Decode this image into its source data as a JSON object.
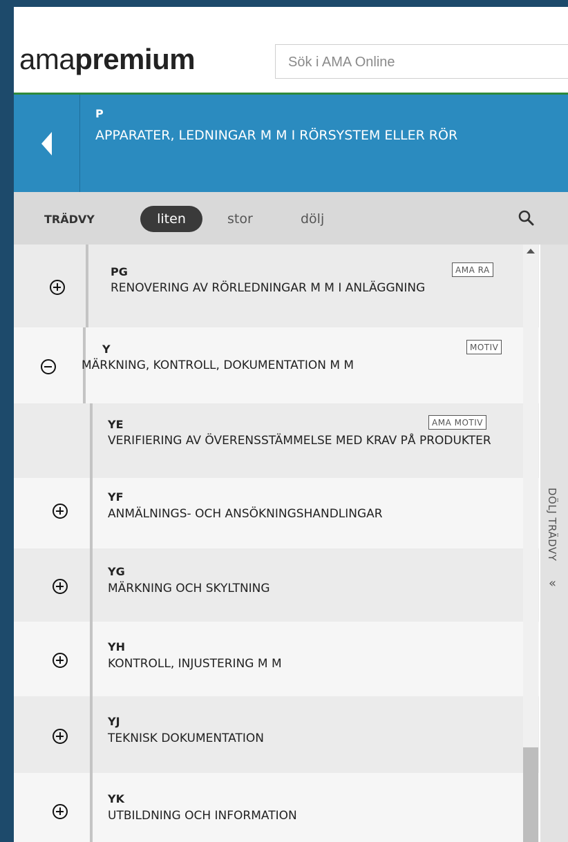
{
  "header": {
    "logo_light": "ama",
    "logo_bold": "premium",
    "search_placeholder": "Sök i AMA Online"
  },
  "banner": {
    "code": "P",
    "title": "APPARATER, LEDNINGAR M M I RÖRSYSTEM ELLER RÖR"
  },
  "toolbar": {
    "label": "TRÄDVY",
    "options": [
      "liten",
      "stor",
      "dölj"
    ],
    "selected": "liten",
    "search_icon": "search-icon"
  },
  "tree": {
    "items": [
      {
        "code": "PG",
        "title": "RENOVERING AV RÖRLEDNINGAR M M I ANLÄGGNING",
        "badge": "AMA RA",
        "state": "collapsed"
      },
      {
        "code": "Y",
        "title": "MÄRKNING, KONTROLL, DOKUMENTATION M M",
        "badge": "MOTIV",
        "state": "expanded"
      },
      {
        "code": "YE",
        "title": "VERIFIERING AV ÖVERENSSTÄMMELSE MED KRAV PÅ PRODUKTER",
        "badge": "AMA MOTIV",
        "state": "leaf"
      },
      {
        "code": "YF",
        "title": "ANMÄLNINGS- OCH ANSÖKNINGSHANDLINGAR",
        "state": "collapsed"
      },
      {
        "code": "YG",
        "title": "MÄRKNING OCH SKYLTNING",
        "state": "collapsed"
      },
      {
        "code": "YH",
        "title": "KONTROLL, INJUSTERING M M",
        "state": "collapsed"
      },
      {
        "code": "YJ",
        "title": "TEKNISK DOKUMENTATION",
        "state": "collapsed"
      },
      {
        "code": "YK",
        "title": "UTBILDNING OCH INFORMATION",
        "state": "collapsed"
      }
    ]
  },
  "side_panel": {
    "hide_label": "DÖLJ TRÄDVY",
    "arrow": "«"
  }
}
